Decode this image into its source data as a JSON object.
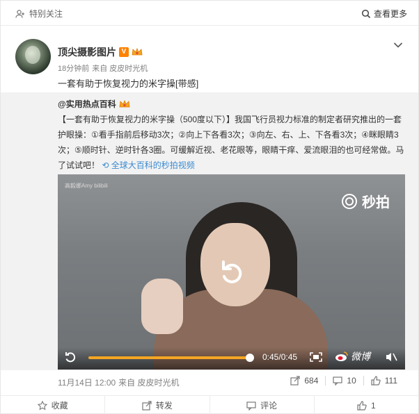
{
  "topbar": {
    "follow_label": "特别关注",
    "view_more_label": "查看更多"
  },
  "author": {
    "name": "顶尖摄影图片",
    "v_badge": "V",
    "time": "18分钟前",
    "source": "来自 皮皮时光机"
  },
  "post": {
    "text": "一套有助于恢复视力的米字操[带感]"
  },
  "repost": {
    "author": "@实用热点百科",
    "text": "【一套有助于恢复视力的米字操（500度以下）】我国飞行员视力标准的制定者研究推出的一套护眼操：①看手指前后移动3次；②向上下各看3次；③向左、右、上、下各看3次；④眯眼睛3次；⑤顺时针、逆时针各3圈。可缓解近视、老花眼等，眼睛干痒、爱流眼泪的也可经常做。马了试试吧！",
    "link_text": "全球大百科的秒拍视频",
    "video": {
      "watermark": "高毅娜Amy",
      "watermark_site": "bilibili",
      "brand": "秒拍",
      "time": "0:45/0:45",
      "progress": 1.0,
      "weibo_label": "微博"
    },
    "footer": {
      "time": "11月14日 12:00",
      "source": "来自 皮皮时光机"
    },
    "stats": {
      "reposts": "684",
      "comments": "10",
      "likes": "111"
    }
  },
  "actions": {
    "favorite": "收藏",
    "repost": "转发",
    "comment": "评论",
    "like": "1"
  }
}
